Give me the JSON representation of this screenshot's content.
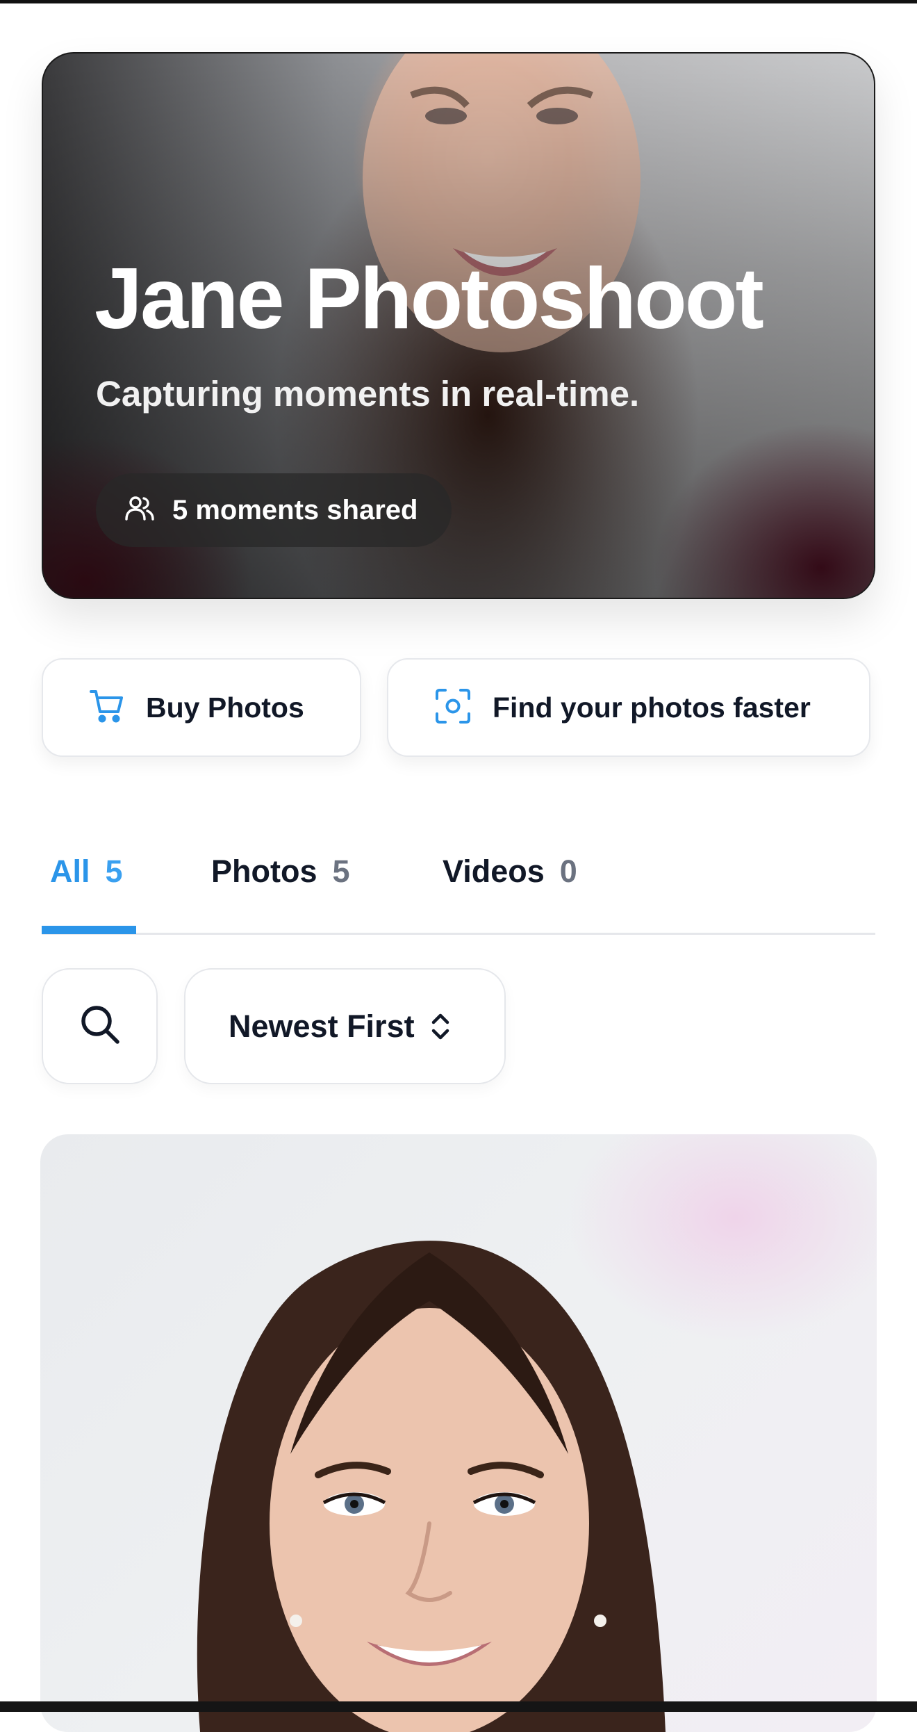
{
  "hero": {
    "title": "Jane Photoshoot",
    "subtitle": "Capturing moments in real-time.",
    "moments_label": "5 moments shared",
    "moments_icon": "users-icon"
  },
  "actions": {
    "buy_label": "Buy Photos",
    "buy_icon": "cart-icon",
    "find_label": "Find your photos faster",
    "find_icon": "face-scan-icon"
  },
  "tabs": [
    {
      "label": "All",
      "count": "5",
      "active": true
    },
    {
      "label": "Photos",
      "count": "5",
      "active": false
    },
    {
      "label": "Videos",
      "count": "0",
      "active": false
    }
  ],
  "filters": {
    "search_icon": "search-icon",
    "sort_label": "Newest First",
    "sort_icon": "chevron-up-down-icon"
  },
  "colors": {
    "accent": "#2b95e9",
    "text": "#111827",
    "muted": "#6b7280",
    "border": "#e5e7eb"
  }
}
